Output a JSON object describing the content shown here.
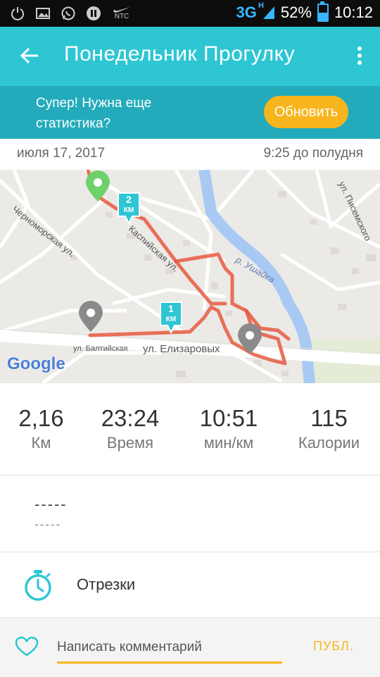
{
  "status_bar": {
    "carrier": "NTC",
    "network": "3G",
    "network_sup": "H",
    "battery": "52%",
    "battery_level": 0.52,
    "time": "10:12",
    "icons": [
      "power-icon",
      "image-icon",
      "whatsapp-icon",
      "pause-icon",
      "nike-icon"
    ]
  },
  "app_bar": {
    "title": "Понедельник Прогулку",
    "back_icon": "arrow-left-icon",
    "menu_icon": "more-vertical-icon"
  },
  "promo": {
    "text": "Супер! Нужна еще статистика?",
    "button": "Обновить"
  },
  "activity": {
    "date": "июля 17, 2017",
    "time": "9:25 до полудня"
  },
  "map": {
    "streets": [
      "Черноморская ул.",
      "Каспийская ул.",
      "ул. Писемского",
      "р. Ушайка",
      "ул. Балтийская",
      "ул. Елизаровых"
    ],
    "km_markers": [
      {
        "value": "2",
        "unit": "КМ"
      },
      {
        "value": "1",
        "unit": "КМ"
      }
    ],
    "logo": "Google",
    "route_color": "#e8593f",
    "start_pin_color": "#6ed16a",
    "water_color": "#a9c9f5"
  },
  "stats": [
    {
      "value": "2,16",
      "label": "Км"
    },
    {
      "value": "23:24",
      "label": "Время"
    },
    {
      "value": "10:51",
      "label": "мин/км"
    },
    {
      "value": "115",
      "label": "Калории"
    }
  ],
  "notes": {
    "line1": "-----",
    "line2": "-----"
  },
  "splits": {
    "label": "Отрезки",
    "icon": "stopwatch-icon"
  },
  "comment": {
    "placeholder": "Написать комментарий",
    "publish": "ПУБЛ.",
    "like_icon": "heart-outline-icon"
  },
  "colors": {
    "appbar": "#2ec6d3",
    "promo": "#23abbb",
    "accent": "#f8b51e"
  }
}
